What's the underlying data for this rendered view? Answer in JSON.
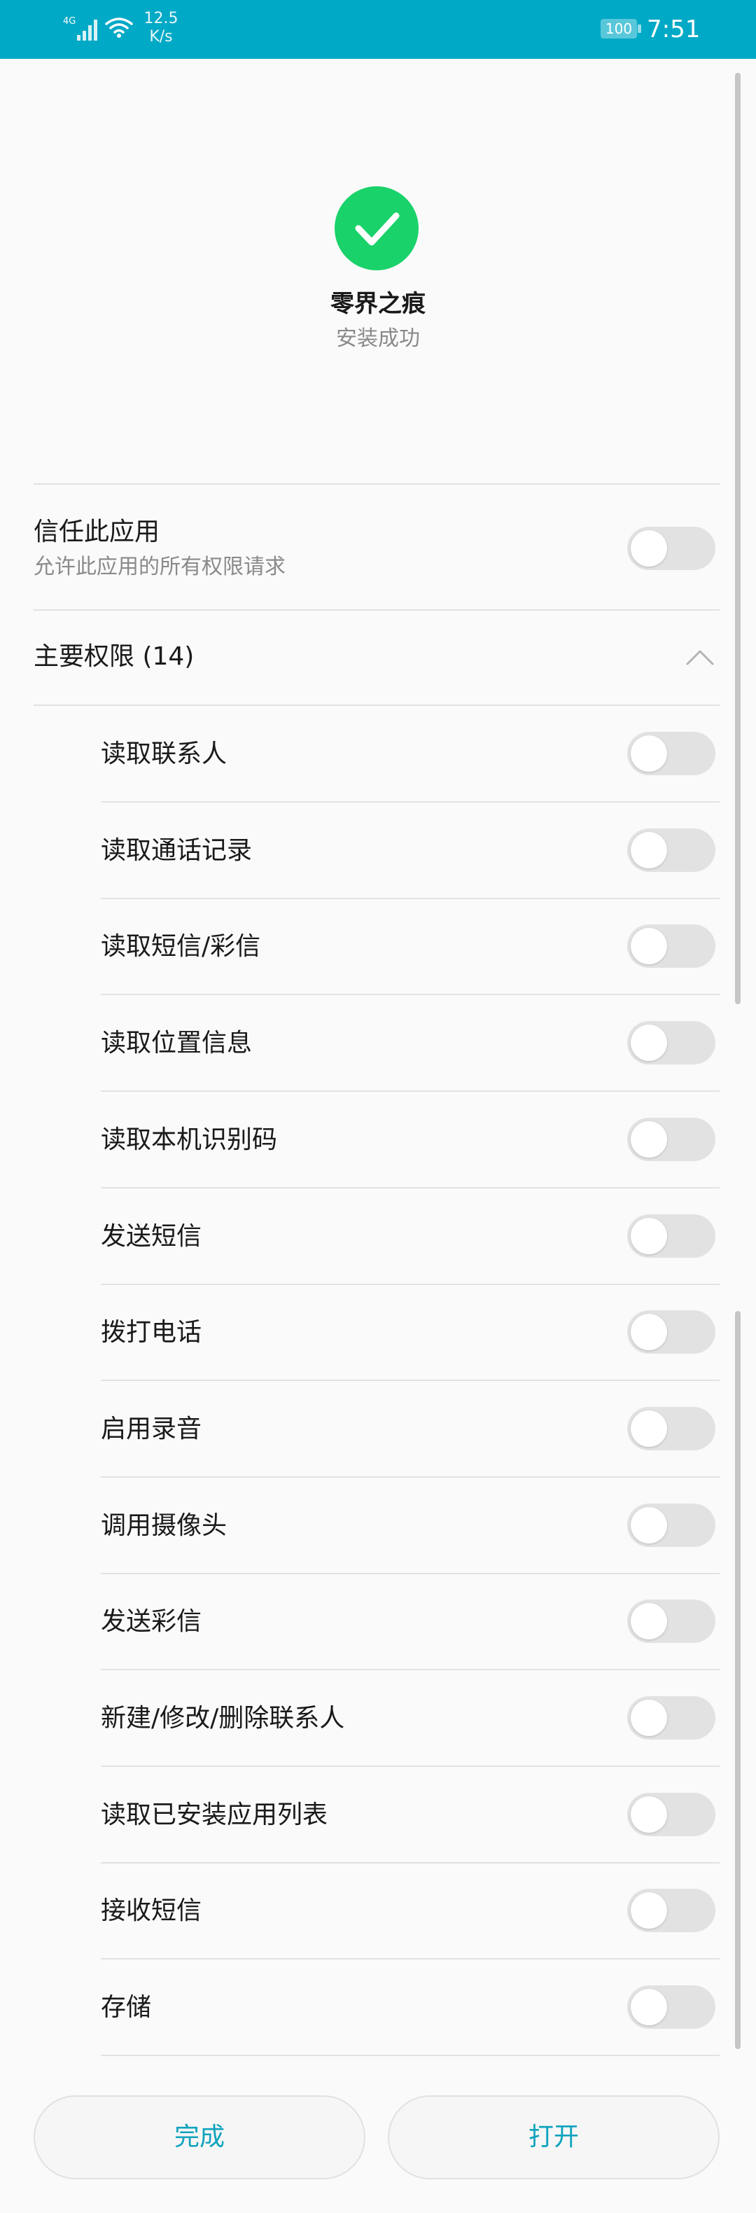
{
  "status_bar": {
    "network": "4G",
    "speed": "12.5\nK/s",
    "battery": "100",
    "time": "7:51"
  },
  "app": {
    "name": "零界之痕",
    "install_status": "安装成功",
    "success_color": "#19d26a",
    "success_icon": "checkmark-icon"
  },
  "trust": {
    "title": "信任此应用",
    "subtitle": "允许此应用的所有权限请求",
    "enabled": false
  },
  "permissions": {
    "header": "主要权限 (14)",
    "expanded": true,
    "items": [
      {
        "label": "读取联系人",
        "enabled": false
      },
      {
        "label": "读取通话记录",
        "enabled": false
      },
      {
        "label": "读取短信/彩信",
        "enabled": false
      },
      {
        "label": "读取位置信息",
        "enabled": false
      },
      {
        "label": "读取本机识别码",
        "enabled": false
      },
      {
        "label": "发送短信",
        "enabled": false
      },
      {
        "label": "拨打电话",
        "enabled": false
      },
      {
        "label": "启用录音",
        "enabled": false
      },
      {
        "label": "调用摄像头",
        "enabled": false
      },
      {
        "label": "发送彩信",
        "enabled": false
      },
      {
        "label": "新建/修改/删除联系人",
        "enabled": false
      },
      {
        "label": "读取已安装应用列表",
        "enabled": false
      },
      {
        "label": "接收短信",
        "enabled": false
      },
      {
        "label": "存储",
        "enabled": false
      }
    ]
  },
  "buttons": {
    "done": "完成",
    "open": "打开",
    "accent_color": "#0fa3bd"
  }
}
